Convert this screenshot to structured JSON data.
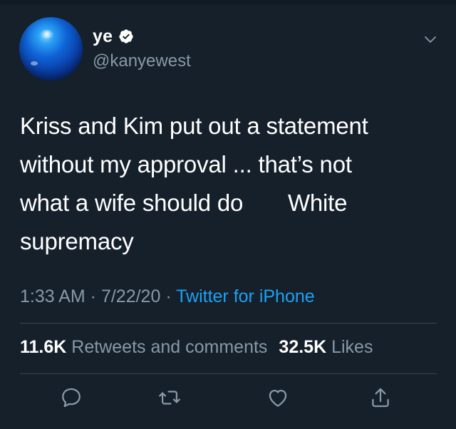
{
  "user": {
    "display_name": "ye",
    "handle": "@kanyewest",
    "verified": true,
    "avatar_icon": "blue-orb-avatar"
  },
  "menu": {
    "icon": "chevron-down-icon"
  },
  "tweet": {
    "lines": [
      "Kriss and Kim put out a statement",
      "without my approval ... that’s not",
      "what a wife should do       White",
      "supremacy"
    ]
  },
  "meta": {
    "time": "1:33 AM",
    "sep1": " · ",
    "date": "7/22/20",
    "sep2": " · ",
    "source": "Twitter for iPhone"
  },
  "stats": {
    "retweets_count": "11.6K",
    "retweets_label": "Retweets and comments",
    "likes_count": "32.5K",
    "likes_label": "Likes"
  },
  "actions": {
    "reply_icon": "reply-icon",
    "retweet_icon": "retweet-icon",
    "like_icon": "heart-icon",
    "share_icon": "share-icon"
  },
  "colors": {
    "background": "#15202b",
    "text_primary": "#ffffff",
    "text_secondary": "#8899a6",
    "accent": "#1da1f2",
    "divider": "#38444d"
  }
}
